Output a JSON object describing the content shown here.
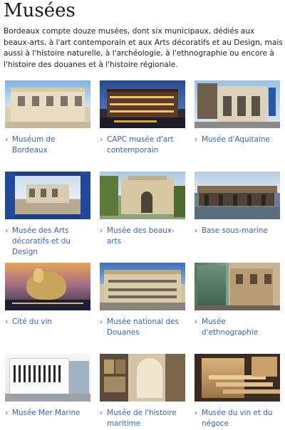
{
  "page": {
    "title": "Musées",
    "intro": "Bordeaux compte douze musées, dont six municipaux, dédiés aux beaux-arts, à l'art contemporain et aux Arts décoratifs et au Design, mais aussi à l'histoire naturelle, à l'archéologie, à l'ethnographie ou encore à l'histoire des douanes et à l'histoire régionale."
  },
  "museums": [
    {
      "label": "Muséum de Bordeaux"
    },
    {
      "label": "CAPC musée d'art contemporain"
    },
    {
      "label": "Musée d'Aquitaine"
    },
    {
      "label": "Musée des Arts décoratifs et du Design"
    },
    {
      "label": "Musée des beaux-arts"
    },
    {
      "label": "Base sous-marine"
    },
    {
      "label": "Cité du vin"
    },
    {
      "label": "Musée national des Douanes"
    },
    {
      "label": "Musée d'ethnographie"
    },
    {
      "label": "Musée Mer Marine"
    },
    {
      "label": "Musée de l'histoire maritime"
    },
    {
      "label": "Musée du vin et du négoce"
    }
  ],
  "icons": {
    "link_chevron": "chevron-right-icon"
  },
  "colors": {
    "link": "#3a63b4",
    "text": "#222222"
  }
}
